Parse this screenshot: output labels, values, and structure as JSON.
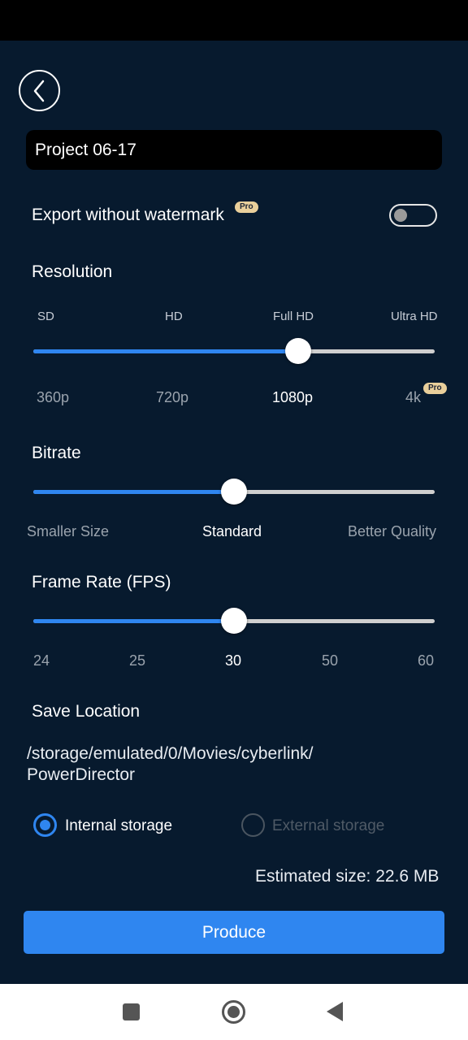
{
  "project_name": "Project 06-17",
  "watermark": {
    "label": "Export without watermark",
    "pro_badge": "Pro",
    "enabled": false
  },
  "resolution": {
    "title": "Resolution",
    "top_labels": [
      "SD",
      "HD",
      "Full HD",
      "Ultra HD"
    ],
    "values": [
      "360p",
      "720p",
      "1080p",
      "4k"
    ],
    "selected": "1080p",
    "level": 0.66,
    "pro_badge": "Pro"
  },
  "bitrate": {
    "title": "Bitrate",
    "labels": [
      "Smaller Size",
      "Standard",
      "Better Quality"
    ],
    "selected": "Standard",
    "level": 0.5
  },
  "frame_rate": {
    "title": "Frame Rate (FPS)",
    "values": [
      "24",
      "25",
      "30",
      "50",
      "60"
    ],
    "selected": "30",
    "level": 0.5
  },
  "save_location": {
    "title": "Save Location",
    "path": "/storage/emulated/0/Movies/cyberlink/\nPowerDirector",
    "internal_label": "Internal storage",
    "external_label": "External storage",
    "selected": "Internal storage"
  },
  "estimated_size": "Estimated size: 22.6 MB",
  "produce_label": "Produce",
  "colors": {
    "accent": "#2f86f0",
    "background": "#071a2e",
    "pro_badge": "#e9cf9b"
  },
  "icons": {
    "back": "chevron-left-icon",
    "nav_recent": "square-icon",
    "nav_home": "circle-icon",
    "nav_back": "triangle-back-icon"
  }
}
